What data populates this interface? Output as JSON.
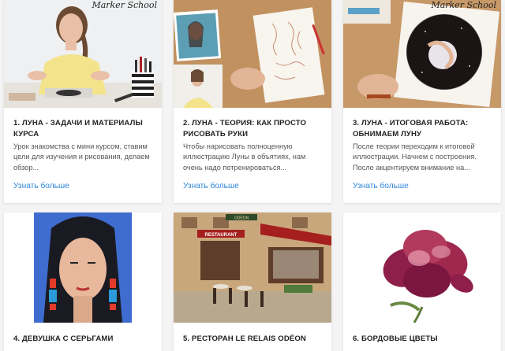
{
  "courses": [
    {
      "title": "1. ЛУНА - ЗАДАЧИ И МАТЕРИАЛЫ КУРСА",
      "description": "Урок знакомства с мини курсом, ставим цели для изучения и рисования, делаем обзор...",
      "link": "Узнать больше",
      "watermark": "Marker School"
    },
    {
      "title": "2. ЛУНА - ТЕОРИЯ: КАК ПРОСТО РИСОВАТЬ РУКИ",
      "description": "Чтобы нарисовать полноценную иллюстрацию Луны в объятиях, нам очень надо потренироваться...",
      "link": "Узнать больше"
    },
    {
      "title": "3. ЛУНА - ИТОГОВАЯ РАБОТА: ОБНИМАЕМ ЛУНУ",
      "description": "После теории переходим к итоговой иллюстрации. Начнем с построения. После акцентируем внимание на...",
      "link": "Узнать больше",
      "watermark": "Marker School"
    },
    {
      "title": "4. ДЕВУШКА С СЕРЬГАМИ"
    },
    {
      "title": "5. РЕСТОРАН LE RELAIS ODÉON",
      "signs": [
        "RESTAURANT",
        "ODÉON"
      ]
    },
    {
      "title": "6. БОРДОВЫЕ ЦВЕТЫ"
    }
  ],
  "colors": {
    "link": "#2f86d8",
    "page_bg": "#f4f4f4"
  }
}
